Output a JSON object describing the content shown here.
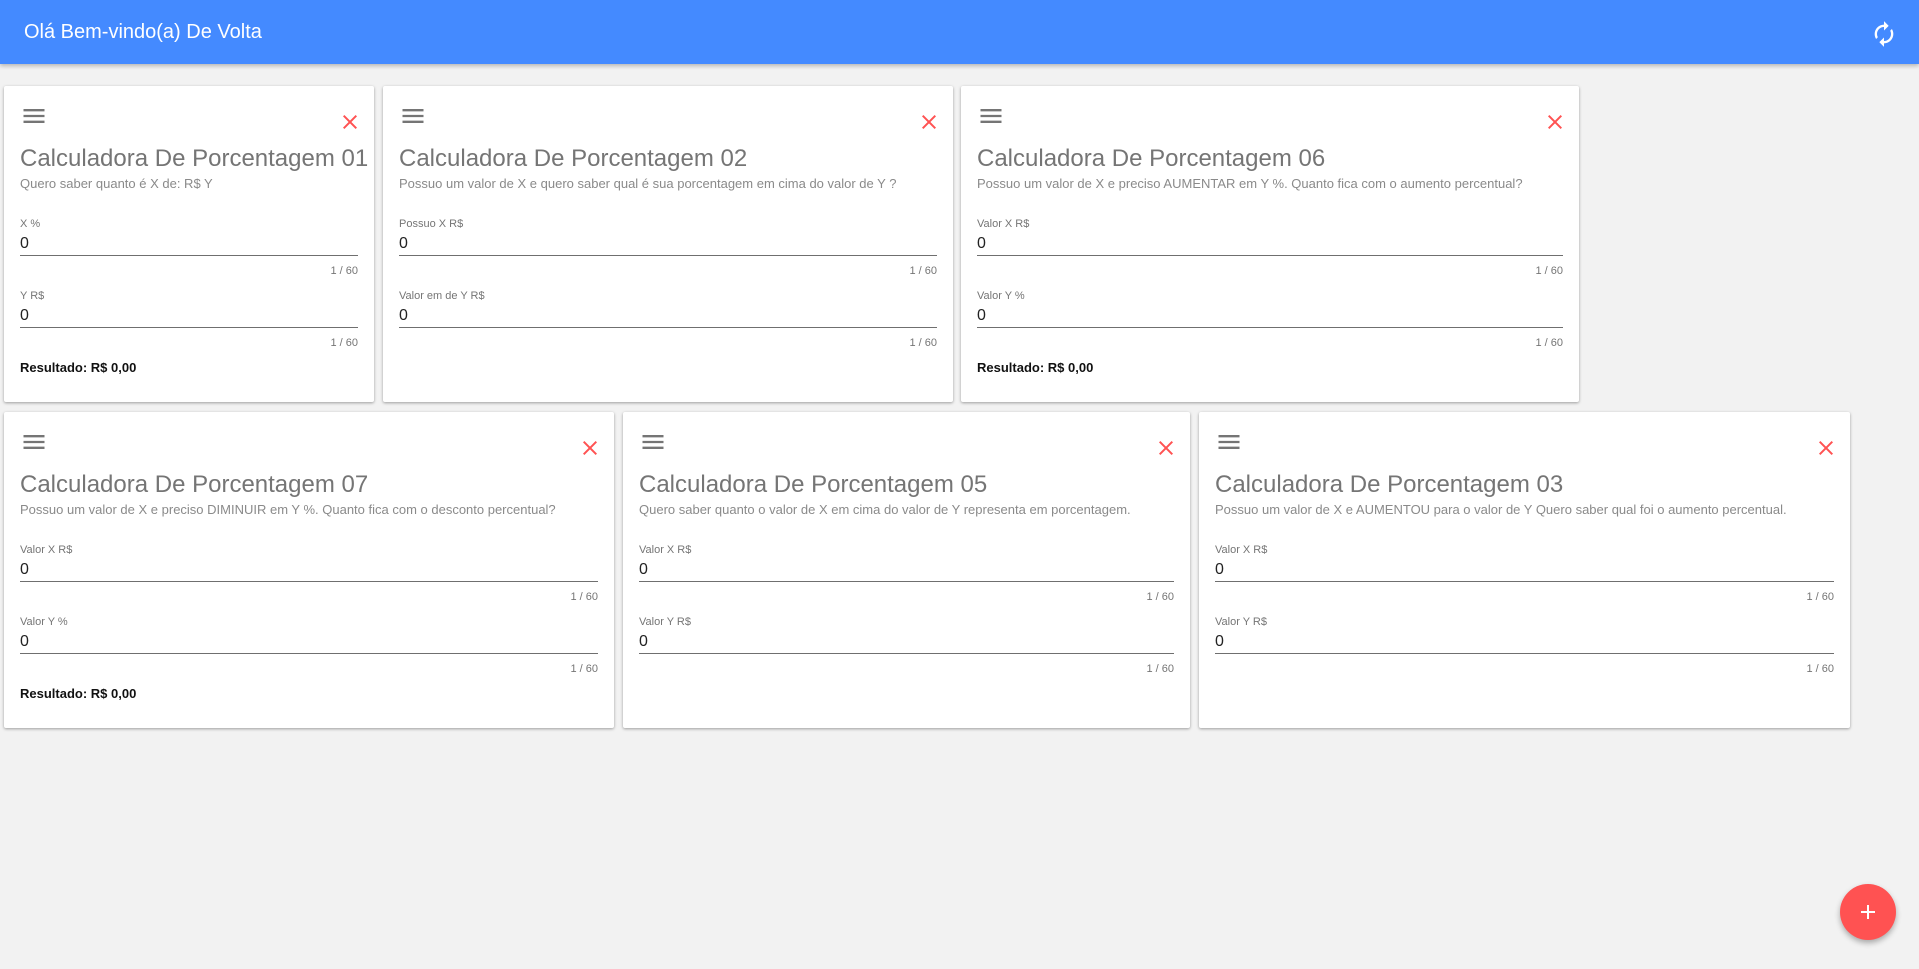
{
  "header": {
    "title": "Olá Bem-vindo(a) De Volta"
  },
  "cards": [
    {
      "title": "Calculadora De Porcentagem 01",
      "subtitle": "Quero saber quanto é X de: R$ Y",
      "fields": [
        {
          "label": "X %",
          "value": "0",
          "counter": "1 / 60"
        },
        {
          "label": "Y R$",
          "value": "0",
          "counter": "1 / 60"
        }
      ],
      "result": "Resultado: R$ 0,00"
    },
    {
      "title": "Calculadora De Porcentagem 02",
      "subtitle": "Possuo um valor de X e quero saber qual é sua porcentagem em cima do valor de Y ?",
      "fields": [
        {
          "label": "Possuo X R$",
          "value": "0",
          "counter": "1 / 60"
        },
        {
          "label": "Valor em de Y R$",
          "value": "0",
          "counter": "1 / 60"
        }
      ]
    },
    {
      "title": "Calculadora De Porcentagem 06",
      "subtitle": "Possuo um valor de X e preciso AUMENTAR em Y %. Quanto fica com o aumento percentual?",
      "fields": [
        {
          "label": "Valor X R$",
          "value": "0",
          "counter": "1 / 60"
        },
        {
          "label": "Valor Y %",
          "value": "0",
          "counter": "1 / 60"
        }
      ],
      "result": "Resultado: R$ 0,00"
    },
    {
      "title": "Calculadora De Porcentagem 07",
      "subtitle": "Possuo um valor de X e preciso DIMINUIR em Y %. Quanto fica com o desconto percentual?",
      "fields": [
        {
          "label": "Valor X R$",
          "value": "0",
          "counter": "1 / 60"
        },
        {
          "label": "Valor Y %",
          "value": "0",
          "counter": "1 / 60"
        }
      ],
      "result": "Resultado: R$ 0,00"
    },
    {
      "title": "Calculadora De Porcentagem 05",
      "subtitle": "Quero saber quanto o valor de X em cima do valor de Y representa em porcentagem.",
      "fields": [
        {
          "label": "Valor X R$",
          "value": "0",
          "counter": "1 / 60"
        },
        {
          "label": "Valor Y R$",
          "value": "0",
          "counter": "1 / 60"
        }
      ]
    },
    {
      "title": "Calculadora De Porcentagem 03",
      "subtitle": "Possuo um valor de X e AUMENTOU para o valor de Y Quero saber qual foi o aumento percentual.",
      "fields": [
        {
          "label": "Valor X R$",
          "value": "0",
          "counter": "1 / 60"
        },
        {
          "label": "Valor Y R$",
          "value": "0",
          "counter": "1 / 60"
        }
      ]
    }
  ],
  "colors": {
    "primary": "#448aff",
    "accent": "#ff5252",
    "background": "#f2f2f2"
  },
  "icons": {
    "refresh": "refresh-icon",
    "drag": "menu-icon",
    "close": "close-icon",
    "add": "add-icon"
  }
}
